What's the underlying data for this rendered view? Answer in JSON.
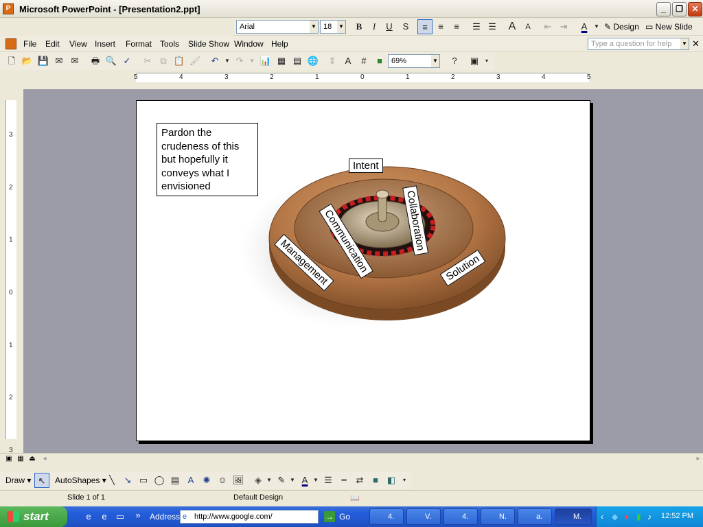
{
  "window": {
    "title": "Microsoft PowerPoint - [Presentation2.ppt]",
    "app_icon": "powerpoint-icon"
  },
  "formatting": {
    "font": "Arial",
    "size": "18",
    "design_label": "Design",
    "new_slide_label": "New Slide"
  },
  "menu": {
    "items": [
      "File",
      "Edit",
      "View",
      "Insert",
      "Format",
      "Tools",
      "Slide Show",
      "Window",
      "Help"
    ],
    "help_placeholder": "Type a question for help"
  },
  "toolbar": {
    "zoom": "69%"
  },
  "ruler": {
    "h_labels": [
      "5",
      "4",
      "3",
      "2",
      "1",
      "0",
      "1",
      "2",
      "3",
      "4",
      "5"
    ],
    "v_labels": [
      "3",
      "2",
      "1",
      "0",
      "1",
      "2",
      "3"
    ]
  },
  "slide": {
    "note_text": "Pardon the crudeness of this but hopefully it conveys what I envisioned",
    "labels": {
      "intent": "Intent",
      "collaboration": "Collaboration",
      "communication": "Communication",
      "management": "Management",
      "solution": "Solution"
    }
  },
  "drawbar": {
    "draw_label": "Draw",
    "autoshapes_label": "AutoShapes"
  },
  "status": {
    "slide_info": "Slide 1 of 1",
    "design_name": "Default Design"
  },
  "taskbar": {
    "start_label": "start",
    "address_label": "Address",
    "address_value": "http://www.google.com/",
    "go_label": "Go",
    "tasks": [
      "4.",
      "V.",
      "4.",
      "N.",
      "a.",
      "M."
    ],
    "clock": "12:52 PM"
  },
  "colors": {
    "slide_bg": "#ffffff",
    "workspace": "#9b9ca8",
    "taskbar": "#245edb",
    "start": "#3a9a3a"
  }
}
